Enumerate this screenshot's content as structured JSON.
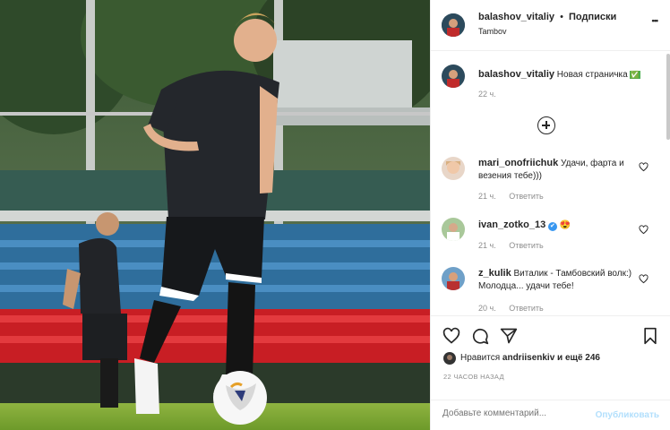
{
  "post": {
    "author": "balashov_vitaliy",
    "separator": "•",
    "follow_label": "Подписки",
    "location": "Tambov",
    "more_label": "•••"
  },
  "caption": {
    "username": "balashov_vitaliy",
    "text": "Новая страничка",
    "emoji": "✅",
    "time": "22 ч."
  },
  "load_more": "⊕",
  "comments": [
    {
      "username": "mari_onofriichuk",
      "text": "Удачи, фарта и везения тебе)))",
      "time": "21 ч.",
      "reply": "Ответить"
    },
    {
      "username": "ivan_zotko_13",
      "verified": "✔",
      "text": "😍",
      "time": "21 ч.",
      "reply": "Ответить"
    },
    {
      "username": "z_kulik",
      "text": "Виталик - Тамбовский волк:) Молодца... удачи тебе!",
      "time": "20 ч.",
      "reply": "Ответить"
    }
  ],
  "likes": {
    "prefix": "Нравится ",
    "user": "andriisenkiv",
    "suffix": " и ещё 246"
  },
  "timestamp": "22 ЧАСОВ НАЗАД",
  "comment_input": {
    "placeholder": "Добавьте комментарий...",
    "publish_label": "Опубликовать"
  },
  "colors": {
    "link_blue": "#b2dffc",
    "verified_blue": "#3897f0",
    "text": "#262626",
    "muted": "#8e8e8e"
  }
}
